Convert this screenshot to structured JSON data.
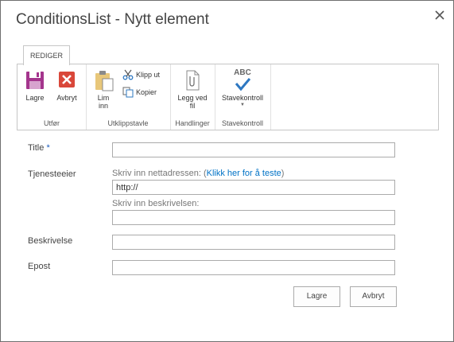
{
  "dialog": {
    "title": "ConditionsList - Nytt element"
  },
  "ribbon": {
    "tab_label": "REDIGER",
    "groups": {
      "commit": {
        "label": "Utfør",
        "save": "Lagre",
        "cancel": "Avbryt"
      },
      "clipboard": {
        "label": "Utklippstavle",
        "paste": "Lim inn",
        "cut": "Klipp ut",
        "copy": "Kopier"
      },
      "actions": {
        "label": "Handlinger",
        "attach": "Legg ved fil"
      },
      "spelling": {
        "label": "Stavekontroll",
        "spellcheck": "Stavekontroll",
        "icon_text": "ABC"
      }
    }
  },
  "form": {
    "title": {
      "label": "Title",
      "required_marker": "*",
      "value": ""
    },
    "service_owner": {
      "label": "Tjenesteeier",
      "url_hint": "Skriv inn nettadressen: (",
      "url_test_link": "Klikk her for å teste",
      "url_hint_end": ")",
      "url_value": "http://",
      "desc_hint": "Skriv inn beskrivelsen:",
      "desc_value": ""
    },
    "description": {
      "label": "Beskrivelse",
      "value": ""
    },
    "email": {
      "label": "Epost",
      "value": ""
    }
  },
  "buttons": {
    "save": "Lagre",
    "cancel": "Avbryt"
  },
  "colors": {
    "save_icon": "#a4358d",
    "cancel_icon": "#d9473a",
    "spell_check": "#2e78c2",
    "link": "#0072c6",
    "required": "#1b5bbd"
  }
}
